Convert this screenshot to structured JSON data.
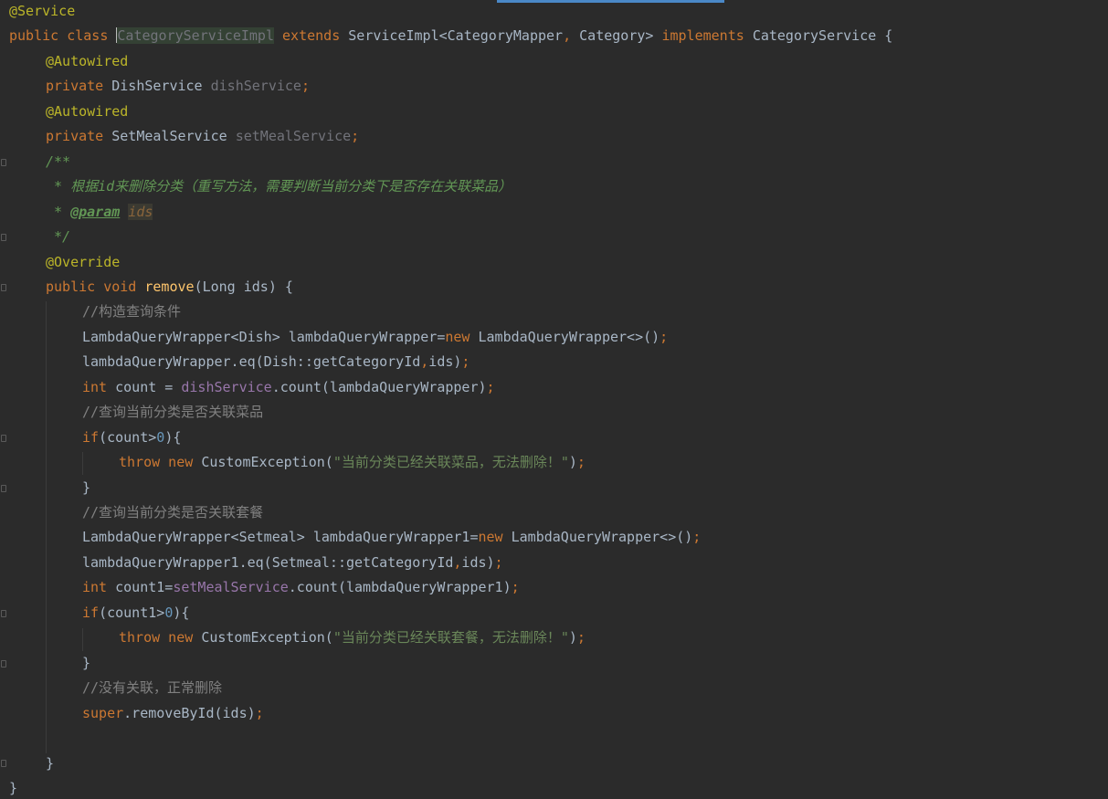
{
  "editor": {
    "lines": [
      {
        "indent": 0,
        "tokens": [
          {
            "c": "ann",
            "t": "@Service"
          }
        ]
      },
      {
        "indent": 0,
        "tokens": [
          {
            "c": "kw",
            "t": "public class "
          },
          {
            "c": "sel-name",
            "t": "CategoryServiceImpl"
          },
          {
            "c": "kw",
            "t": " extends "
          },
          {
            "c": "plain",
            "t": "ServiceImpl<CategoryMapper"
          },
          {
            "c": "kw",
            "t": ", "
          },
          {
            "c": "plain",
            "t": "Category> "
          },
          {
            "c": "kw",
            "t": "implements "
          },
          {
            "c": "plain",
            "t": "CategoryService {"
          }
        ]
      },
      {
        "indent": 1,
        "tokens": [
          {
            "c": "ann",
            "t": "@Autowired"
          }
        ]
      },
      {
        "indent": 1,
        "tokens": [
          {
            "c": "kw",
            "t": "private "
          },
          {
            "c": "plain",
            "t": "DishService "
          },
          {
            "c": "unused",
            "t": "dishService"
          },
          {
            "c": "kw",
            "t": ";"
          }
        ]
      },
      {
        "indent": 1,
        "tokens": [
          {
            "c": "ann",
            "t": "@Autowired"
          }
        ]
      },
      {
        "indent": 1,
        "tokens": [
          {
            "c": "kw",
            "t": "private "
          },
          {
            "c": "plain",
            "t": "SetMealService "
          },
          {
            "c": "unused",
            "t": "setMealService"
          },
          {
            "c": "kw",
            "t": ";"
          }
        ]
      },
      {
        "indent": 1,
        "tokens": [
          {
            "c": "doc",
            "t": "/**"
          }
        ]
      },
      {
        "indent": 1,
        "tokens": [
          {
            "c": "doc",
            "t": " * 根据id来删除分类（重写方法，需要判断当前分类下是否存在关联菜品）"
          }
        ]
      },
      {
        "indent": 1,
        "tokens": [
          {
            "c": "doc",
            "t": " * "
          },
          {
            "c": "doctag",
            "t": "@param"
          },
          {
            "c": "doc",
            "t": " "
          },
          {
            "c": "docparam",
            "t": "ids"
          }
        ]
      },
      {
        "indent": 1,
        "tokens": [
          {
            "c": "doc",
            "t": " */"
          }
        ]
      },
      {
        "indent": 1,
        "tokens": [
          {
            "c": "ann",
            "t": "@Override"
          }
        ]
      },
      {
        "indent": 1,
        "tokens": [
          {
            "c": "kw",
            "t": "public void "
          },
          {
            "c": "mth",
            "t": "remove"
          },
          {
            "c": "plain",
            "t": "(Long ids) {"
          }
        ]
      },
      {
        "indent": 2,
        "tokens": [
          {
            "c": "cmt",
            "t": "//构造查询条件"
          }
        ]
      },
      {
        "indent": 2,
        "tokens": [
          {
            "c": "plain",
            "t": "LambdaQueryWrapper<Dish> lambdaQueryWrapper="
          },
          {
            "c": "kw",
            "t": "new "
          },
          {
            "c": "plain",
            "t": "LambdaQueryWrapper<>()"
          },
          {
            "c": "kw",
            "t": ";"
          }
        ]
      },
      {
        "indent": 2,
        "tokens": [
          {
            "c": "plain",
            "t": "lambdaQueryWrapper.eq(Dish::getCategoryId"
          },
          {
            "c": "kw",
            "t": ","
          },
          {
            "c": "plain",
            "t": "ids)"
          },
          {
            "c": "kw",
            "t": ";"
          }
        ]
      },
      {
        "indent": 2,
        "tokens": [
          {
            "c": "kw",
            "t": "int "
          },
          {
            "c": "plain",
            "t": "count = "
          },
          {
            "c": "fld",
            "t": "dishService"
          },
          {
            "c": "plain",
            "t": ".count(lambdaQueryWrapper)"
          },
          {
            "c": "kw",
            "t": ";"
          }
        ]
      },
      {
        "indent": 2,
        "tokens": [
          {
            "c": "cmt",
            "t": "//查询当前分类是否关联菜品"
          }
        ]
      },
      {
        "indent": 2,
        "tokens": [
          {
            "c": "kw",
            "t": "if"
          },
          {
            "c": "plain",
            "t": "(count>"
          },
          {
            "c": "num",
            "t": "0"
          },
          {
            "c": "plain",
            "t": "){"
          }
        ]
      },
      {
        "indent": 3,
        "tokens": [
          {
            "c": "kw",
            "t": "throw new "
          },
          {
            "c": "plain",
            "t": "CustomException("
          },
          {
            "c": "str",
            "t": "\"当前分类已经关联菜品，无法删除！\""
          },
          {
            "c": "plain",
            "t": ")"
          },
          {
            "c": "kw",
            "t": ";"
          }
        ]
      },
      {
        "indent": 2,
        "tokens": [
          {
            "c": "plain",
            "t": "}"
          }
        ]
      },
      {
        "indent": 2,
        "tokens": [
          {
            "c": "cmt",
            "t": "//查询当前分类是否关联套餐"
          }
        ]
      },
      {
        "indent": 2,
        "tokens": [
          {
            "c": "plain",
            "t": "LambdaQueryWrapper<Setmeal> lambdaQueryWrapper1="
          },
          {
            "c": "kw",
            "t": "new "
          },
          {
            "c": "plain",
            "t": "LambdaQueryWrapper<>()"
          },
          {
            "c": "kw",
            "t": ";"
          }
        ]
      },
      {
        "indent": 2,
        "tokens": [
          {
            "c": "plain",
            "t": "lambdaQueryWrapper1.eq(Setmeal::getCategoryId"
          },
          {
            "c": "kw",
            "t": ","
          },
          {
            "c": "plain",
            "t": "ids)"
          },
          {
            "c": "kw",
            "t": ";"
          }
        ]
      },
      {
        "indent": 2,
        "tokens": [
          {
            "c": "kw",
            "t": "int "
          },
          {
            "c": "plain",
            "t": "count1="
          },
          {
            "c": "fld",
            "t": "setMealService"
          },
          {
            "c": "plain",
            "t": ".count(lambdaQueryWrapper1)"
          },
          {
            "c": "kw",
            "t": ";"
          }
        ]
      },
      {
        "indent": 2,
        "tokens": [
          {
            "c": "kw",
            "t": "if"
          },
          {
            "c": "plain",
            "t": "(count1>"
          },
          {
            "c": "num",
            "t": "0"
          },
          {
            "c": "plain",
            "t": "){"
          }
        ]
      },
      {
        "indent": 3,
        "tokens": [
          {
            "c": "kw",
            "t": "throw new "
          },
          {
            "c": "plain",
            "t": "CustomException("
          },
          {
            "c": "str",
            "t": "\"当前分类已经关联套餐，无法删除！\""
          },
          {
            "c": "plain",
            "t": ")"
          },
          {
            "c": "kw",
            "t": ";"
          }
        ]
      },
      {
        "indent": 2,
        "tokens": [
          {
            "c": "plain",
            "t": "}"
          }
        ]
      },
      {
        "indent": 2,
        "tokens": [
          {
            "c": "cmt",
            "t": "//没有关联，正常删除"
          }
        ]
      },
      {
        "indent": 2,
        "tokens": [
          {
            "c": "kw",
            "t": "super"
          },
          {
            "c": "plain",
            "t": ".removeById(ids)"
          },
          {
            "c": "kw",
            "t": ";"
          }
        ]
      },
      {
        "indent": 2,
        "tokens": []
      },
      {
        "indent": 1,
        "tokens": [
          {
            "c": "plain",
            "t": "}"
          }
        ]
      },
      {
        "indent": 0,
        "tokens": [
          {
            "c": "plain",
            "t": "}"
          }
        ]
      }
    ]
  }
}
